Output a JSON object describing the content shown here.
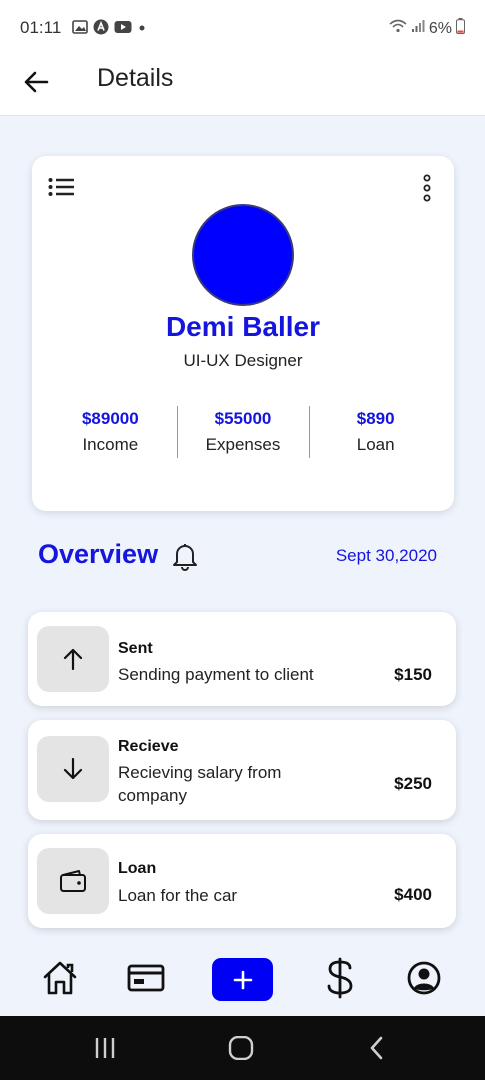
{
  "status_bar": {
    "time": "01:11",
    "battery": "6%",
    "icons": [
      "image-icon",
      "a-icon",
      "youtube-icon",
      "dot-icon",
      "wifi-icon",
      "signal-icon",
      "battery-icon"
    ]
  },
  "header": {
    "title": "Details",
    "back_icon": "arrow-left-icon"
  },
  "profile": {
    "name": "Demi Baller",
    "role": "UI-UX Designer",
    "avatar_color": "#0000ff",
    "stats": [
      {
        "value": "$89000",
        "label": "Income"
      },
      {
        "value": "$55000",
        "label": "Expenses"
      },
      {
        "value": "$890",
        "label": "Loan"
      }
    ]
  },
  "overview": {
    "title": "Overview",
    "date": "Sept 30,2020"
  },
  "transactions": [
    {
      "icon": "arrow-up-icon",
      "title": "Sent",
      "description": "Sending payment to client",
      "amount": "$150"
    },
    {
      "icon": "arrow-down-icon",
      "title": "Recieve",
      "description": "Recieving salary from company",
      "amount": "$250"
    },
    {
      "icon": "wallet-icon",
      "title": "Loan",
      "description": "Loan for the car",
      "amount": "$400"
    }
  ],
  "bottom_nav": [
    "home-icon",
    "card-icon",
    "plus-icon",
    "dollar-icon",
    "profile-icon"
  ],
  "colors": {
    "accent": "#1515dd",
    "background": "#eef3fc",
    "add_button": "#0000f5"
  }
}
